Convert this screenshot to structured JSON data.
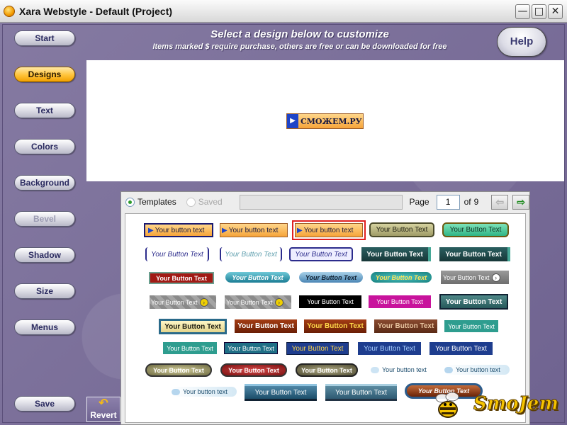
{
  "window": {
    "title": "Xara Webstyle - Default (Project)",
    "min": "—",
    "max": "□",
    "close": "✕"
  },
  "nav": {
    "start": "Start",
    "designs": "Designs",
    "text": "Text",
    "colors": "Colors",
    "background": "Background",
    "bevel": "Bevel",
    "shadow": "Shadow",
    "size": "Size",
    "menus": "Menus",
    "save": "Save",
    "revert": "Revert",
    "active": "Designs",
    "disabled": [
      "Bevel"
    ]
  },
  "header": {
    "title": "Select a design below to customize",
    "subtitle": "Items marked $ require purchase, others are free or can be downloaded for free",
    "help": "Help"
  },
  "preview": {
    "button_text": "СМОЖЕМ.РУ",
    "icon": "play-arrow-icon",
    "accent": "#1e44c8"
  },
  "browser": {
    "templates_label": "Templates",
    "saved_label": "Saved",
    "page_label": "Page",
    "page_value": "1",
    "of_label": "of",
    "page_total": "9",
    "prev_icon": "arrow-left-icon",
    "next_icon": "arrow-right-icon"
  },
  "templates": [
    "Your button text",
    "Your button text",
    "Your button text",
    "Your Button Text",
    "Your Button Text",
    "Your Button Text",
    "Your Button Text",
    "Your Button Text",
    "Your Button Text",
    "Your Button Text",
    "Your Button Text",
    "Your Button Text",
    "Your Button Text",
    "Your Button Text",
    "Your Button Text",
    "Your Button Text",
    "Your Button Text",
    "Your Button Text",
    "Your Button Text",
    "Your Button Text",
    "Your Button Text",
    "Your Button Text",
    "Your Button Text",
    "Your Button Text",
    "Your Button Text",
    "Your Button Text",
    "Your Button Text",
    "Your Button Text",
    "Your Button Text",
    "Your Button Text",
    "Your Button Text",
    "Your Button Text",
    "Your Button Text",
    "Your button text",
    "Your button text",
    "Your button text",
    "Your Button Text",
    "Your Button Text",
    "Your Button Text"
  ],
  "watermark": {
    "text": "SmoJem"
  }
}
